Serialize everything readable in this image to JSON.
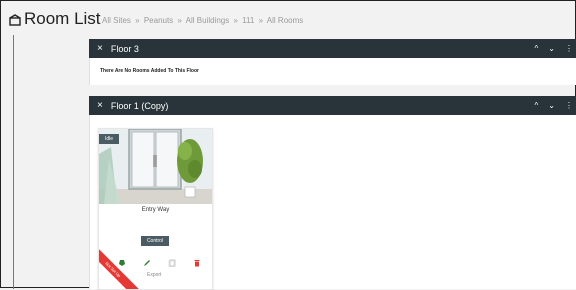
{
  "header": {
    "title": "Room List",
    "breadcrumb": [
      "All Sites",
      "Peanuts",
      "All Buildings",
      "111",
      "All Rooms"
    ],
    "breadcrumb_separator": "»"
  },
  "floors": [
    {
      "name": "Floor 3",
      "empty_message": "There Are No Rooms Added To This Floor"
    },
    {
      "name": "Floor 1 (Copy)"
    }
  ],
  "room": {
    "status": "Idle",
    "name": "Entry Way",
    "control_label": "Control",
    "export_label": "Export",
    "ribbon_text": "Not Set Up"
  },
  "icons": {
    "close": "×",
    "collapse": "^",
    "expand": "⌄",
    "more": "⋮"
  },
  "colors": {
    "floor_bar": "#283439",
    "badge": "#4b5b63",
    "ribbon": "#e53935",
    "status_icon": "#2e7d32",
    "edit_icon": "#2e7d32",
    "delete_icon": "#e53935"
  }
}
